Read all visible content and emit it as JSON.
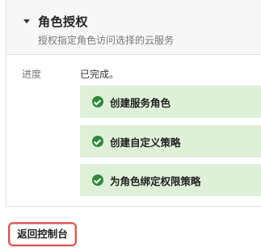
{
  "panel": {
    "title": "角色授权",
    "subtitle": "授权指定角色访问选择的云服务"
  },
  "progress": {
    "label": "进度",
    "status": "已完成。",
    "steps": [
      {
        "label": "创建服务角色",
        "icon": "check-circle-icon"
      },
      {
        "label": "创建自定义策略",
        "icon": "check-circle-icon"
      },
      {
        "label": "为角色绑定权限策略",
        "icon": "check-circle-icon"
      }
    ]
  },
  "actions": {
    "back_label": "返回控制台"
  },
  "colors": {
    "success_bg": "#dff0d8",
    "success_icon": "#2e8a3a",
    "button_focus_border": "#e8524f"
  }
}
